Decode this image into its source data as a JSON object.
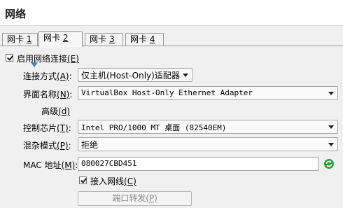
{
  "header": {
    "title": "网络"
  },
  "tabs": [
    {
      "label": "网卡 ",
      "num": "1",
      "active": false
    },
    {
      "label": "网卡 ",
      "num": "2",
      "active": true
    },
    {
      "label": "网卡 ",
      "num": "3",
      "active": false
    },
    {
      "label": "网卡 ",
      "num": "4",
      "active": false
    }
  ],
  "enable": {
    "label": "启用网络连接",
    "shortcut": "(E)",
    "checked": true
  },
  "attached_to": {
    "label": "连接方式",
    "shortcut": "(A)",
    "colon": ":",
    "value": "仅主机(Host-Only)适配器"
  },
  "name": {
    "label": "界面名称",
    "shortcut": "(N)",
    "colon": ":",
    "value": "VirtualBox Host-Only Ethernet Adapter"
  },
  "advanced": {
    "label": "高级",
    "shortcut": "(d)"
  },
  "adapter_type": {
    "label": "控制芯片",
    "shortcut": "(T)",
    "colon": ":",
    "value": "Intel PRO/1000 MT 桌面 (82540EM)"
  },
  "promiscuous": {
    "label": "混杂模式",
    "shortcut": "(P)",
    "colon": ":",
    "value": "拒绝"
  },
  "mac": {
    "label": "MAC 地址",
    "shortcut": "(M)",
    "colon": ":",
    "value": "080027CBD451"
  },
  "cable": {
    "label": "接入网线",
    "shortcut": "(C)",
    "checked": true
  },
  "port_forwarding": {
    "label": "端口转发",
    "shortcut": "(P)"
  },
  "icons": {
    "refresh": "refresh-icon",
    "advanced_toggle": "triangle-down-icon"
  },
  "colors": {
    "accent": "#3f86c9",
    "refresh_green": "#2e9e3a"
  }
}
